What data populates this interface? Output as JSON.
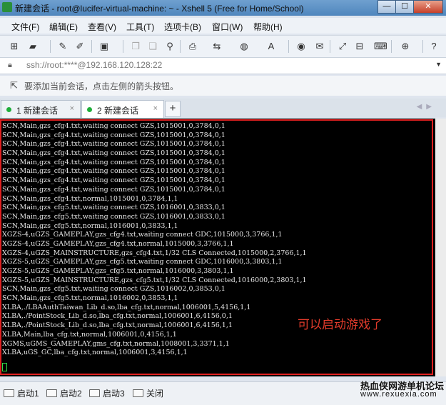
{
  "window": {
    "title": "新建会话 - root@lucifer-virtual-machine: ~ - Xshell 5 (Free for Home/School)",
    "minimize": "—",
    "maximize": "☐",
    "close": "✕"
  },
  "menu": [
    "文件(F)",
    "编辑(E)",
    "查看(V)",
    "工具(T)",
    "选项卡(B)",
    "窗口(W)",
    "帮助(H)"
  ],
  "toolbar_icons": [
    "new-session-icon",
    "open-folder-icon",
    "disconnect-icon",
    "reconnect-icon",
    "properties-icon",
    "copy-icon",
    "paste-icon",
    "find-icon",
    "print-icon",
    "transfer-icon",
    "globe-icon",
    "font-icon",
    "script-icon",
    "compose-icon",
    "fullscreen-icon",
    "lock-icon",
    "keyboard-icon",
    "add-icon",
    "help-icon"
  ],
  "address": {
    "value": "ssh://root:****@192.168.120.128:22"
  },
  "hint": "要添加当前会话，点击左侧的箭头按钮。",
  "tabs": [
    {
      "label": "1 新建会话",
      "close": "×"
    },
    {
      "label": "2 新建会话",
      "close": "×"
    }
  ],
  "tab_add": "+",
  "terminal": {
    "lines": [
      "SCN,Main,gzs_cfg4.txt,waiting connect GZS,1015001,0,3784,0,1",
      "SCN,Main,gzs_cfg4.txt,waiting connect GZS,1015001,0,3784,0,1",
      "SCN,Main,gzs_cfg4.txt,waiting connect GZS,1015001,0,3784,0,1",
      "SCN,Main,gzs_cfg4.txt,waiting connect GZS,1015001,0,3784,0,1",
      "SCN,Main,gzs_cfg4.txt,waiting connect GZS,1015001,0,3784,0,1",
      "SCN,Main,gzs_cfg4.txt,waiting connect GZS,1015001,0,3784,0,1",
      "SCN,Main,gzs_cfg4.txt,waiting connect GZS,1015001,0,3784,0,1",
      "SCN,Main,gzs_cfg4.txt,waiting connect GZS,1015001,0,3784,0,1",
      "SCN,Main,gzs_cfg4.txt,normal,1015001,0,3784,1,1",
      "SCN,Main,gzs_cfg5.txt,waiting connect GZS,1016001,0,3833,0,1",
      "SCN,Main,gzs_cfg5.txt,waiting connect GZS,1016001,0,3833,0,1",
      "SCN,Main,gzs_cfg5.txt,normal,1016001,0,3833,1,1",
      "XGZS-4,uGZS_GAMEPLAY,gzs_cfg4.txt,waiting connect GDC,1015000,3,3766,1,1",
      "XGZS-4,uGZS_GAMEPLAY,gzs_cfg4.txt,normal,1015000,3,3766,1,1",
      "XGZS-4,uGZS_MAINSTRUCTURE,gzs_cfg4.txt,1/32 CLS Connected,1015000,2,3766,1,1",
      "XGZS-5,uGZS_GAMEPLAY,gzs_cfg5.txt,waiting connect GDC,1016000,3,3803,1,1",
      "XGZS-5,uGZS_GAMEPLAY,gzs_cfg5.txt,normal,1016000,3,3803,1,1",
      "XGZS-5,uGZS_MAINSTRUCTURE,gzs_cfg5.txt,1/32 CLS Connected,1016000,2,3803,1,1",
      "SCN,Main,gzs_cfg5.txt,waiting connect GZS,1016002,0,3853,0,1",
      "SCN,Main,gzs_cfg5.txt,normal,1016002,0,3853,1,1",
      "XLBA,./LBAAuthTaiwan_Lib_d.so,lba_cfg.txt,normal,1006001,5,4156,1,1",
      "XLBA,./PointStock_Lib_d.so,lba_cfg.txt,normal,1006001,6,4156,0,1",
      "XLBA,./PointStock_Lib_d.so,lba_cfg.txt,normal,1006001,6,4156,1,1",
      "XLBA,Main,lba_cfg.txt,normal,1006001,0,4156,1,1",
      "XGMS,uGMS_GAMEPLAY,gms_cfg.txt,normal,1008001,3,3371,1,1",
      "XLBA,uGS_GC,lba_cfg.txt,normal,1006001,3,4156,1,1"
    ]
  },
  "annotation": "可以启动游戏了",
  "bottom_buttons": [
    "启动1",
    "启动2",
    "启动3",
    "关闭"
  ],
  "watermark": {
    "line1": "热血侠网游单机论坛",
    "line2": "www.rexuexia.com"
  },
  "colors": {
    "title_bar": "#5b8fc4",
    "terminal_bg": "#000000",
    "terminal_text": "#e6e6e6",
    "highlight_border": "#e02020",
    "annotation": "#e23b2b",
    "tab_status": "#1fae3a"
  }
}
